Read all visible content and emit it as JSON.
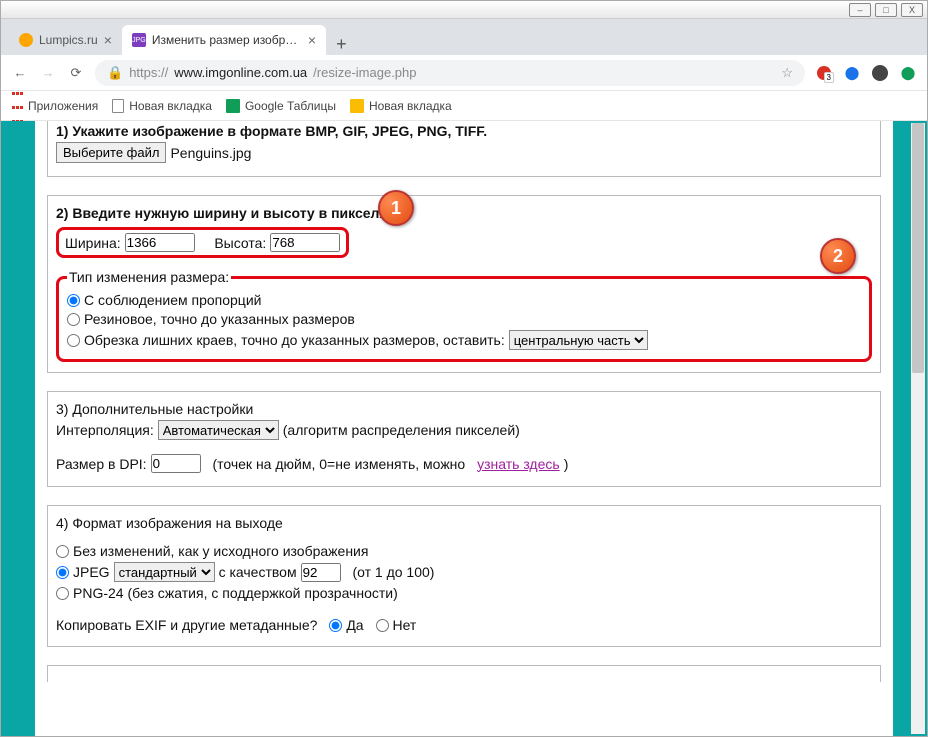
{
  "window": {
    "min": "–",
    "max": "□",
    "close": "X"
  },
  "tabs": {
    "t1": "Lumpics.ru",
    "t2": "Изменить размер изображения",
    "close": "×",
    "new": "+"
  },
  "nav": {
    "back": "←",
    "fwd": "→",
    "reload": "⟳"
  },
  "url": {
    "lock": "🔒",
    "proto": "https://",
    "host": "www.imgonline.com.ua",
    "path": "/resize-image.php",
    "star": "☆"
  },
  "ext": {
    "e1": "⬤",
    "e2": "⬤",
    "e3": "⬤",
    "e4": "⬤"
  },
  "bookmarks": {
    "apps": "Приложения",
    "b1": "Новая вкладка",
    "b2": "Google Таблицы",
    "b3": "Новая вкладка"
  },
  "s1": {
    "title": "1) Укажите изображение в формате BMP, GIF, JPEG, PNG, TIFF.",
    "choose": "Выберите файл",
    "filename": "Penguins.jpg"
  },
  "s2": {
    "title": "2) Введите нужную ширину и высоту в пикселях.",
    "widthLabel": "Ширина:",
    "widthVal": "1366",
    "heightLabel": "Высота:",
    "heightVal": "768",
    "legend": "Тип изменения размера:",
    "opt1": "С соблюдением пропорций",
    "opt2": "Резиновое, точно до указанных размеров",
    "opt3": "Обрезка лишних краев, точно до указанных размеров, оставить:",
    "crop": "центральную часть"
  },
  "s3": {
    "title": "3) Дополнительные настройки",
    "interpLabel": "Интерполяция:",
    "interpVal": "Автоматическая",
    "interpHint": "(алгоритм распределения пикселей)",
    "dpiLabel": "Размер в DPI:",
    "dpiVal": "0",
    "dpiHint1": "(точек на дюйм, 0=не изменять, можно",
    "dpiLink": "узнать здесь",
    "dpiHint2": ")"
  },
  "s4": {
    "title": "4) Формат изображения на выходе",
    "opt1": "Без изменений, как у исходного изображения",
    "jpeg": "JPEG",
    "jpegQualSel": "стандартный",
    "jpegQualLabel": "с качеством",
    "jpegQualVal": "92",
    "jpegHint": "(от 1 до 100)",
    "png": "PNG-24 (без сжатия, с поддержкой прозрачности)",
    "exifLabel": "Копировать EXIF и другие метаданные?",
    "yes": "Да",
    "no": "Нет"
  },
  "badges": {
    "b1": "1",
    "b2": "2"
  }
}
